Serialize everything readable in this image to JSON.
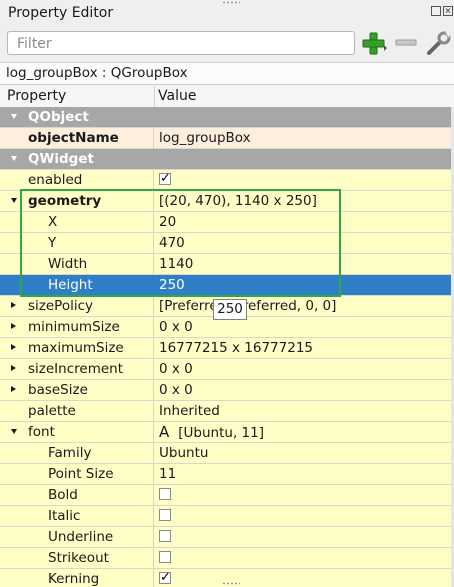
{
  "panel": {
    "title": "Property Editor"
  },
  "filter": {
    "placeholder": "Filter"
  },
  "toolbar": {
    "add_icon": "plus-icon",
    "remove_icon": "minus-icon",
    "configure_icon": "wrench-icon"
  },
  "object_header": "log_groupBox : QGroupBox",
  "columns": {
    "property": "Property",
    "value": "Value"
  },
  "rows": [
    {
      "kind": "cat",
      "label": "QObject"
    },
    {
      "kind": "pink",
      "label": "objectName",
      "value": "log_groupBox",
      "bold": true
    },
    {
      "kind": "cat",
      "label": "QWidget"
    },
    {
      "kind": "yel",
      "label": "enabled",
      "check": true
    },
    {
      "kind": "yel",
      "label": "geometry",
      "value": "[(20, 470), 1140 x 250]",
      "bold": true,
      "expand": "down"
    },
    {
      "kind": "yel",
      "label": "X",
      "value": "20",
      "indent": 1
    },
    {
      "kind": "yel",
      "label": "Y",
      "value": "470",
      "indent": 1
    },
    {
      "kind": "yel",
      "label": "Width",
      "value": "1140",
      "indent": 1
    },
    {
      "kind": "sel",
      "label": "Height",
      "value": "250",
      "indent": 1
    },
    {
      "kind": "yel",
      "label": "sizePolicy",
      "value": "[Preferred, Preferred, 0, 0]",
      "expand": "right"
    },
    {
      "kind": "yel",
      "label": "minimumSize",
      "value": "0 x 0",
      "expand": "right"
    },
    {
      "kind": "yel",
      "label": "maximumSize",
      "value": "16777215 x 16777215",
      "expand": "right"
    },
    {
      "kind": "yel",
      "label": "sizeIncrement",
      "value": "0 x 0",
      "expand": "right"
    },
    {
      "kind": "yel",
      "label": "baseSize",
      "value": "0 x 0",
      "expand": "right"
    },
    {
      "kind": "yel",
      "label": "palette",
      "value": "Inherited"
    },
    {
      "kind": "yel",
      "label": "font",
      "value": "[Ubuntu, 11]",
      "expand": "down",
      "font_icon": "A"
    },
    {
      "kind": "yel",
      "label": "Family",
      "value": "Ubuntu",
      "indent": 1
    },
    {
      "kind": "yel",
      "label": "Point Size",
      "value": "11",
      "indent": 1
    },
    {
      "kind": "yel",
      "label": "Bold",
      "check": false,
      "indent": 1
    },
    {
      "kind": "yel",
      "label": "Italic",
      "check": false,
      "indent": 1
    },
    {
      "kind": "yel",
      "label": "Underline",
      "check": false,
      "indent": 1
    },
    {
      "kind": "yel",
      "label": "Strikeout",
      "check": false,
      "indent": 1
    },
    {
      "kind": "yel",
      "label": "Kerning",
      "check": true,
      "indent": 1
    }
  ],
  "tooltip": "250",
  "colors": {
    "category": "#a7a7a7",
    "selection": "#2f7fc6",
    "highlight": "#2ea84a",
    "row": "#fffec6"
  }
}
